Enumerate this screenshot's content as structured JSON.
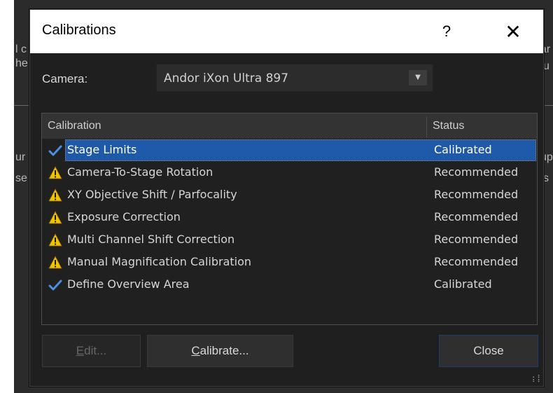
{
  "dialog": {
    "title": "Calibrations",
    "help_label": "?",
    "close_icon_glyph": "✕"
  },
  "camera": {
    "label": "Camera:",
    "selected": "Andor iXon Ultra 897"
  },
  "list": {
    "columns": [
      "Calibration",
      "Status"
    ],
    "rows": [
      {
        "icon": "checkmark-icon",
        "name": "Stage Limits",
        "status": "Calibrated",
        "selected": true
      },
      {
        "icon": "warning-icon",
        "name": "Camera-To-Stage Rotation",
        "status": "Recommended"
      },
      {
        "icon": "warning-icon",
        "name": "XY Objective Shift / Parfocality",
        "status": "Recommended"
      },
      {
        "icon": "warning-icon",
        "name": "Exposure Correction",
        "status": "Recommended"
      },
      {
        "icon": "warning-icon",
        "name": "Multi Channel Shift Correction",
        "status": "Recommended"
      },
      {
        "icon": "warning-icon",
        "name": "Manual Magnification Calibration",
        "status": "Recommended"
      },
      {
        "icon": "checkmark-icon",
        "name": "Define Overview Area",
        "status": "Calibrated"
      }
    ]
  },
  "buttons": {
    "edit_mnemonic": "E",
    "edit_rest": "dit...",
    "calibrate_mnemonic": "C",
    "calibrate_rest": "alibrate...",
    "close": "Close"
  },
  "background_fragments": [
    "l c",
    "he",
    "ar",
    "u",
    "ur s",
    "se",
    "up",
    "s"
  ],
  "colors": {
    "dialog_bg": "#1f1f1f",
    "selection": "#1f59a9",
    "warning": "#f2c200",
    "check": "#4a8fe0"
  }
}
